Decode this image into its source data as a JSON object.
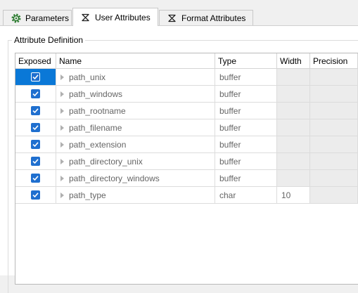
{
  "tabs": [
    {
      "label": "Parameters",
      "icon": "gear-icon",
      "active": false
    },
    {
      "label": "User Attributes",
      "icon": "sigma-icon",
      "active": true
    },
    {
      "label": "Format Attributes",
      "icon": "sigma-icon",
      "active": false
    }
  ],
  "group": {
    "title": "Attribute Definition"
  },
  "table": {
    "columns": [
      "Exposed",
      "Name",
      "Type",
      "Width",
      "Precision"
    ],
    "rows": [
      {
        "exposed": true,
        "name": "path_unix",
        "type": "buffer",
        "width": "",
        "precision": ""
      },
      {
        "exposed": true,
        "name": "path_windows",
        "type": "buffer",
        "width": "",
        "precision": ""
      },
      {
        "exposed": true,
        "name": "path_rootname",
        "type": "buffer",
        "width": "",
        "precision": ""
      },
      {
        "exposed": true,
        "name": "path_filename",
        "type": "buffer",
        "width": "",
        "precision": ""
      },
      {
        "exposed": true,
        "name": "path_extension",
        "type": "buffer",
        "width": "",
        "precision": ""
      },
      {
        "exposed": true,
        "name": "path_directory_unix",
        "type": "buffer",
        "width": "",
        "precision": ""
      },
      {
        "exposed": true,
        "name": "path_directory_windows",
        "type": "buffer",
        "width": "",
        "precision": ""
      },
      {
        "exposed": true,
        "name": "path_type",
        "type": "char",
        "width": "10",
        "precision": ""
      }
    ]
  },
  "colors": {
    "selection": "#0a78d7",
    "checkbox": "#1f6fcf",
    "disabled_cell": "#ececec"
  }
}
